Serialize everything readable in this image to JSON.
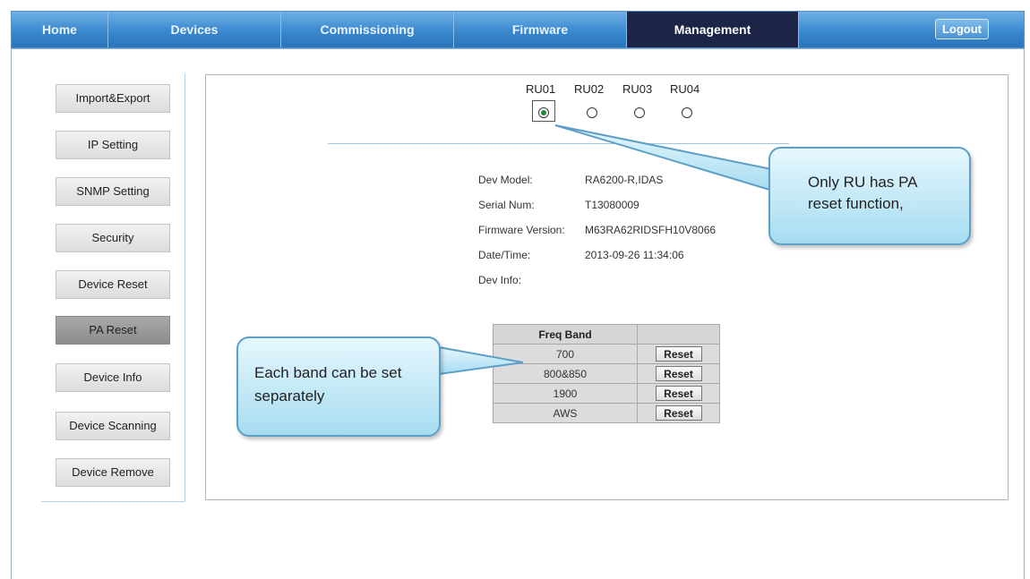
{
  "nav": {
    "tabs": [
      "Home",
      "Devices",
      "Commissioning",
      "Firmware",
      "Management"
    ],
    "active_tab": "Management",
    "logout": "Logout"
  },
  "sidebar": {
    "items": [
      "Import&Export",
      "IP Setting",
      "SNMP Setting",
      "Security",
      "Device Reset",
      "PA Reset",
      "Device Info",
      "Device Scanning",
      "Device Remove"
    ],
    "active": "PA Reset"
  },
  "ru_selector": {
    "options": [
      "RU01",
      "RU02",
      "RU03",
      "RU04"
    ],
    "selected": "RU01"
  },
  "device_info": [
    {
      "label": "Dev Model:",
      "value": "RA6200-R,IDAS"
    },
    {
      "label": "Serial Num:",
      "value": "T13080009"
    },
    {
      "label": "Firmware Version:",
      "value": "M63RA62RIDSFH10V8066"
    },
    {
      "label": "Date/Time:",
      "value": "2013-09-26 11:34:06"
    },
    {
      "label": "Dev Info:",
      "value": ""
    }
  ],
  "freq_table": {
    "header": "Freq Band",
    "button_label": "Reset",
    "bands": [
      "700",
      "800&850",
      "1900",
      "AWS"
    ]
  },
  "callouts": {
    "ru_note": "Only RU has PA reset function,",
    "band_note": "Each band can be set separately"
  },
  "colors": {
    "nav_blue": "#3a88cf",
    "nav_active": "#1c2447",
    "callout_fill": "#a6dcf1"
  }
}
